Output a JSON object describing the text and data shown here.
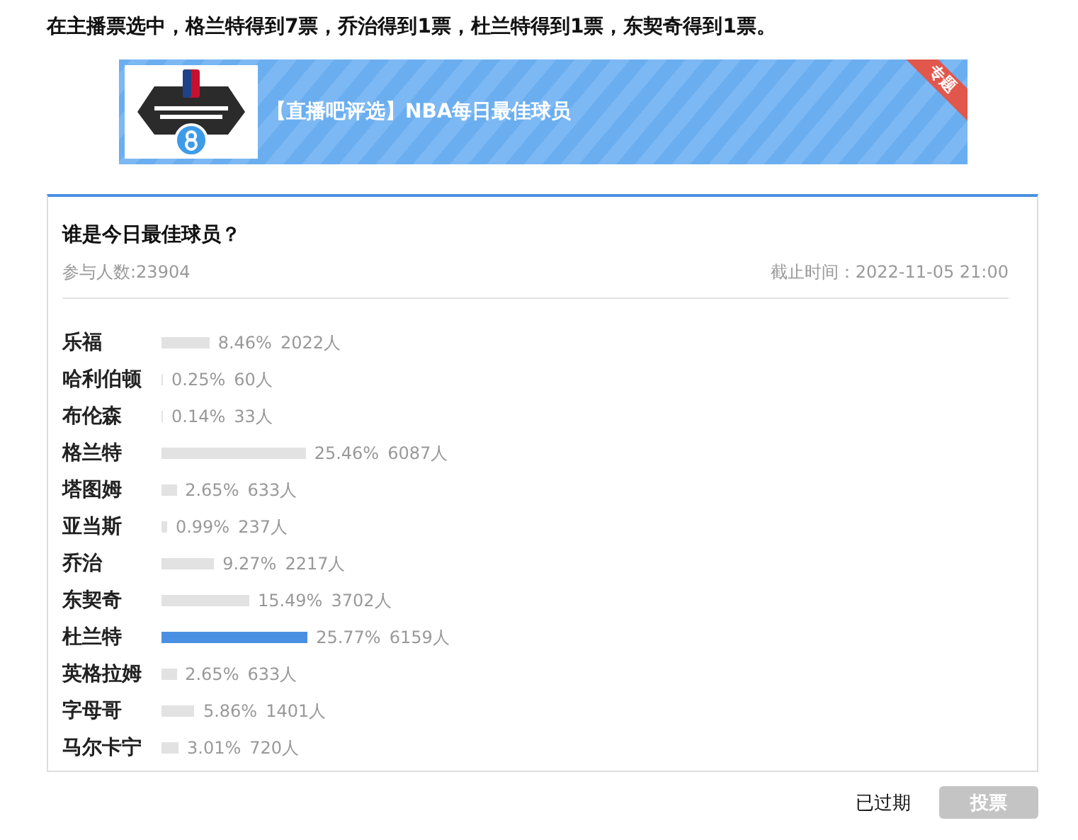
{
  "headline": "在主播票选中，格兰特得到7票，乔治得到1票，杜兰特得到1票，东契奇得到1票。",
  "banner": {
    "title": "【直播吧评选】NBA每日最佳球员",
    "ribbon": "专题"
  },
  "poll": {
    "question": "谁是今日最佳球员？",
    "participants": "参与人数:23904",
    "deadline": "截止时间：2022-11-05 21:00",
    "options": [
      {
        "name": "乐福",
        "percent": "8.46%",
        "votes": "2022人",
        "selected": false
      },
      {
        "name": "哈利伯顿",
        "percent": "0.25%",
        "votes": "60人",
        "selected": false
      },
      {
        "name": "布伦森",
        "percent": "0.14%",
        "votes": "33人",
        "selected": false
      },
      {
        "name": "格兰特",
        "percent": "25.46%",
        "votes": "6087人",
        "selected": false
      },
      {
        "name": "塔图姆",
        "percent": "2.65%",
        "votes": "633人",
        "selected": false
      },
      {
        "name": "亚当斯",
        "percent": "0.99%",
        "votes": "237人",
        "selected": false
      },
      {
        "name": "乔治",
        "percent": "9.27%",
        "votes": "2217人",
        "selected": false
      },
      {
        "name": "东契奇",
        "percent": "15.49%",
        "votes": "3702人",
        "selected": false
      },
      {
        "name": "杜兰特",
        "percent": "25.77%",
        "votes": "6159人",
        "selected": true
      },
      {
        "name": "英格拉姆",
        "percent": "2.65%",
        "votes": "633人",
        "selected": false
      },
      {
        "name": "字母哥",
        "percent": "5.86%",
        "votes": "1401人",
        "selected": false
      },
      {
        "name": "马尔卡宁",
        "percent": "3.01%",
        "votes": "720人",
        "selected": false
      }
    ]
  },
  "footer": {
    "status": "已过期",
    "vote_button": {
      "label": "投票",
      "disabled": true
    }
  }
}
